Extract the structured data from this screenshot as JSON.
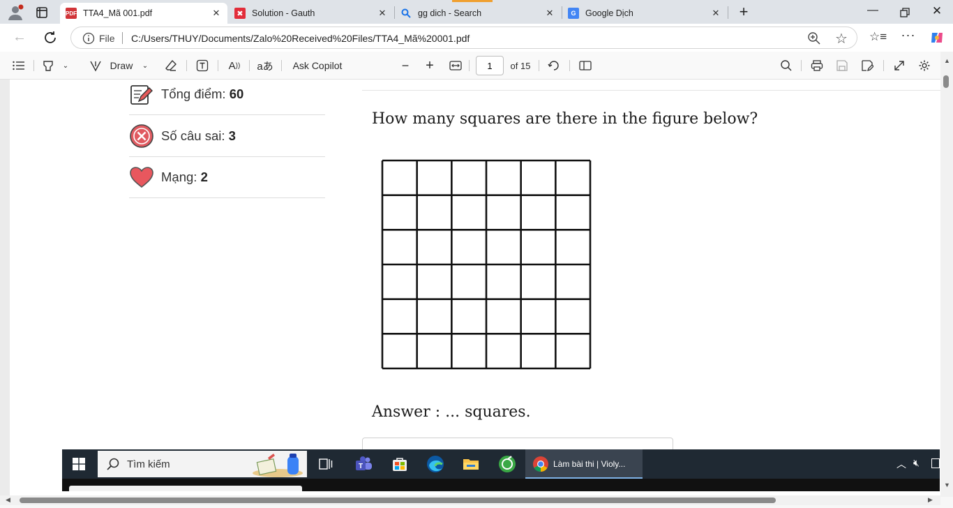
{
  "tabs": [
    {
      "label": "TTA4_Mã 001.pdf",
      "icon": "pdf-icon"
    },
    {
      "label": "Solution - Gauth",
      "icon": "gauth-icon"
    },
    {
      "label": "gg dich - Search",
      "icon": "search-icon"
    },
    {
      "label": "Google Dịch",
      "icon": "google-translate-icon"
    }
  ],
  "address": {
    "scheme_label": "File",
    "url": "C:/Users/THUY/Documents/Zalo%20Received%20Files/TTA4_Mã%20001.pdf"
  },
  "pdf_toolbar": {
    "draw_label": "Draw",
    "copilot_label": "Ask Copilot",
    "page_number": "1",
    "page_total": "of 15"
  },
  "sidebar": {
    "items": [
      {
        "label": "Tổng điểm:",
        "value": "60",
        "icon": "score-pencil-icon"
      },
      {
        "label": "Số câu sai:",
        "value": "3",
        "icon": "wrong-x-icon"
      },
      {
        "label": "Mạng:",
        "value": "2",
        "icon": "heart-icon"
      }
    ]
  },
  "question": {
    "text": "How many squares are there in the figure below?",
    "grid_rows": 6,
    "grid_cols": 6,
    "answer_text": "Answer : ...  squares."
  },
  "taskbar": {
    "search_placeholder": "Tìm kiếm",
    "active_app_label": "Làm bài thi | Violy..."
  },
  "colors": {
    "tab_bar": "#dfe3e8",
    "taskbar": "#1f2933",
    "heart": "#e8575e",
    "wrong": "#e05a60"
  }
}
